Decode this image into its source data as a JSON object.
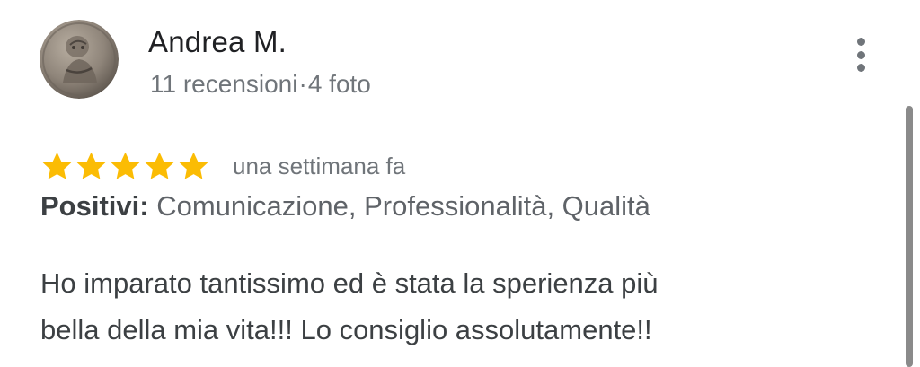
{
  "author": {
    "name": "Andrea M.",
    "reviews_count": "11 recensioni",
    "separator": "·",
    "photos_count": "4 foto"
  },
  "review": {
    "rating": 5,
    "rating_max": 5,
    "star_color": "#fbbc04",
    "date": "una settimana fa",
    "positives_label": "Positivi:",
    "positives_value": "Comunicazione, Professionalità, Qualità",
    "text_line1": "Ho imparato tantissimo ed è stata la sperienza più",
    "text_line2": "bella della mia vita!!! Lo consiglio assolutamente!!"
  },
  "icons": {
    "menu": "more-vert-icon",
    "star": "star-icon"
  }
}
